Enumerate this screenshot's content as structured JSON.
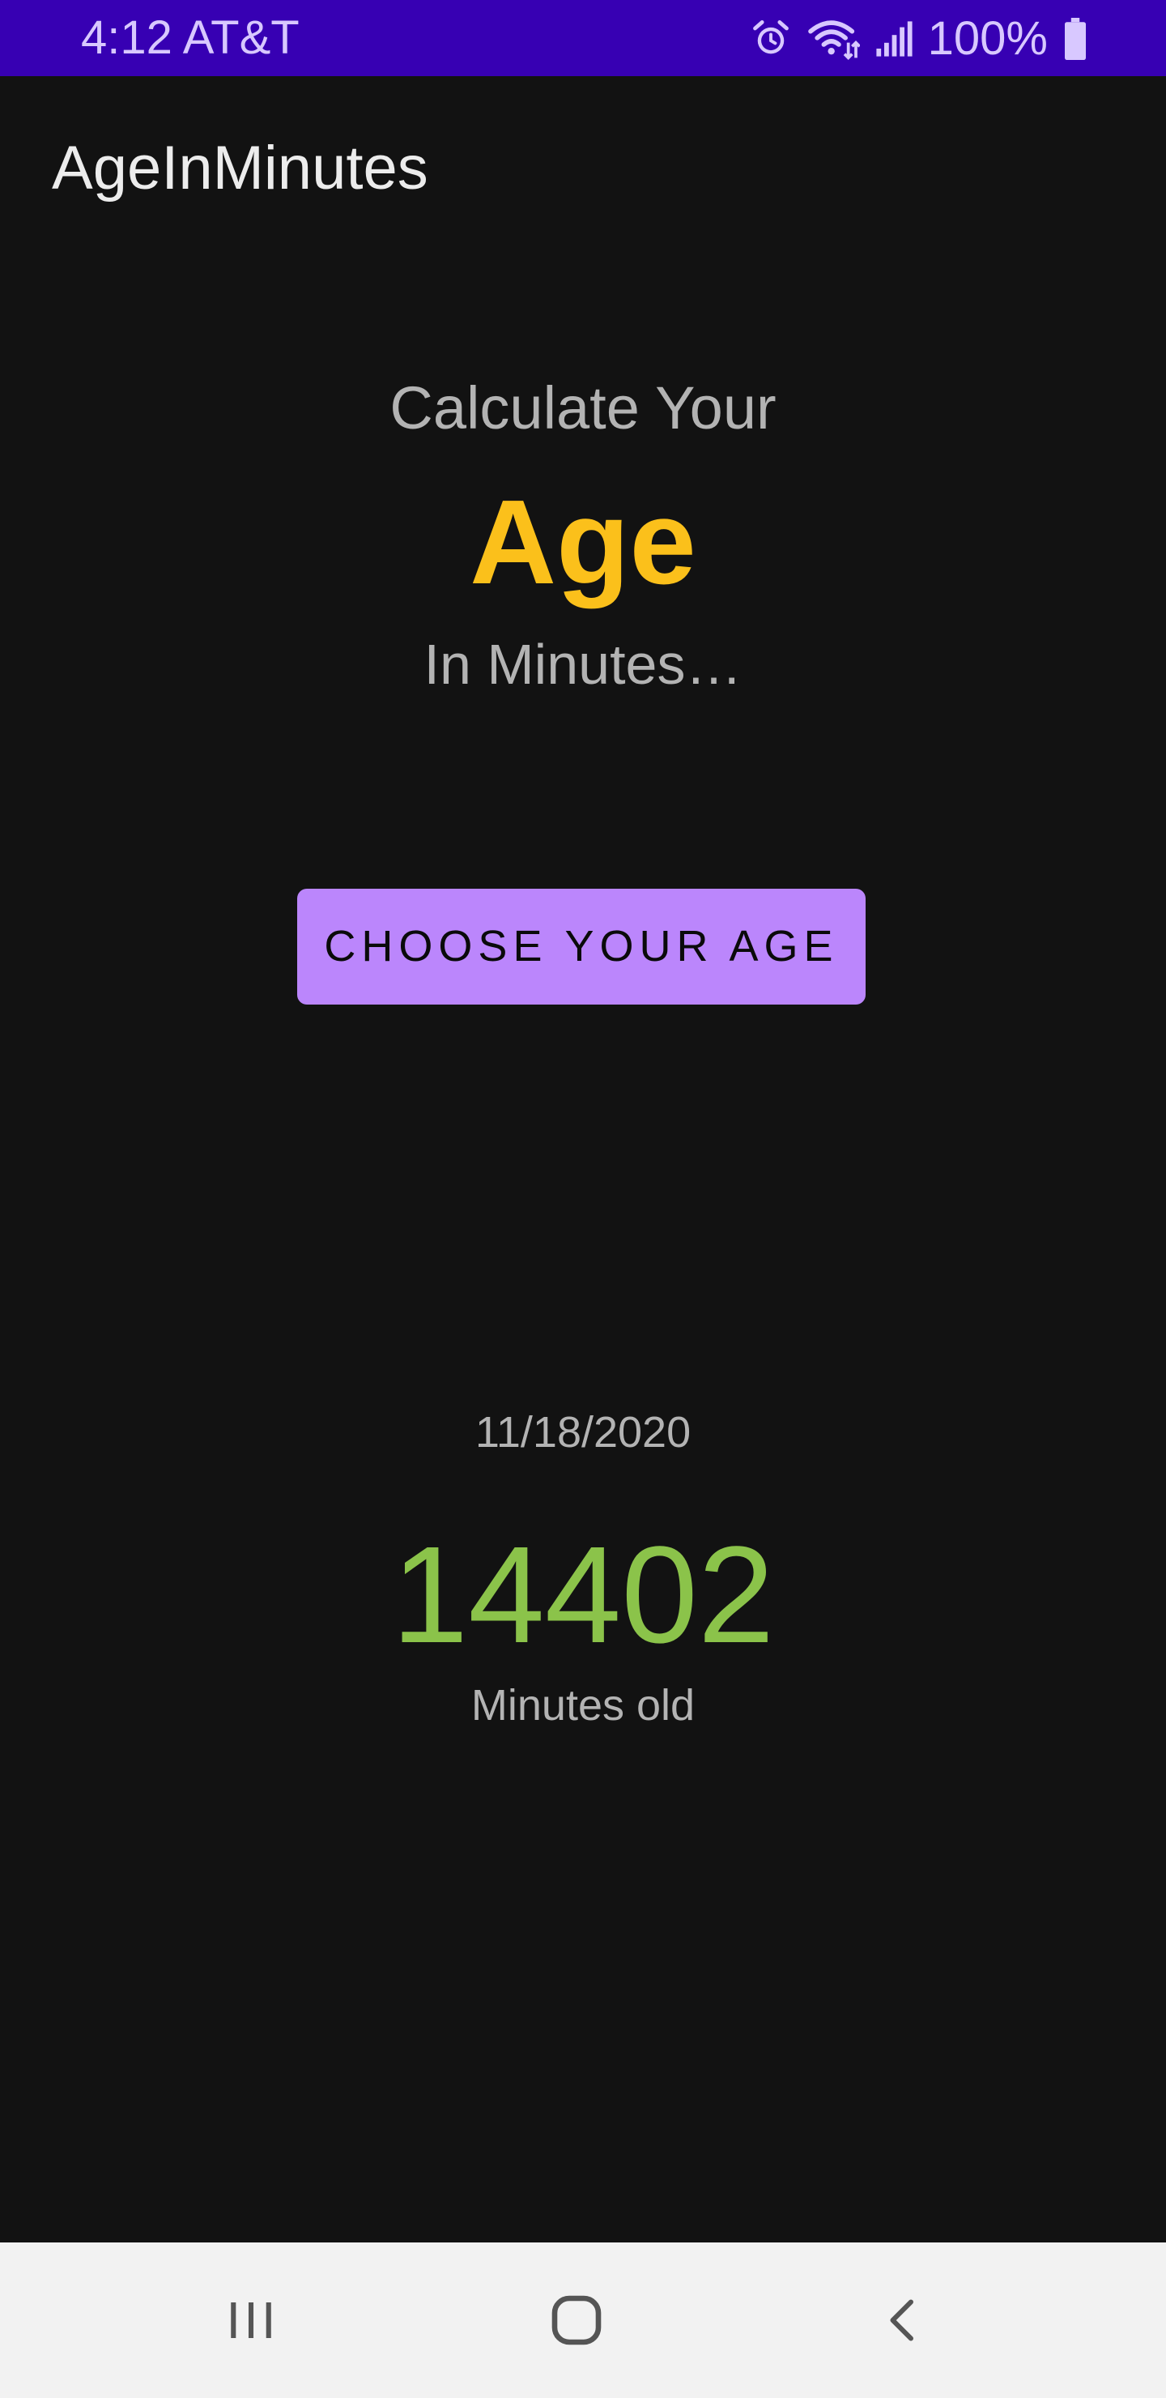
{
  "status_bar": {
    "time_carrier": "4:12 AT&T",
    "battery": "100%",
    "icons": [
      "alarm-icon",
      "wifi-icon",
      "signal-icon",
      "battery-icon"
    ],
    "background": "#3700B3"
  },
  "app_bar": {
    "title": "AgeInMinutes"
  },
  "main": {
    "headline_line1": "Calculate Your",
    "headline_line2": "Age",
    "headline_line3": "In Minutes…",
    "choose_button": "CHOOSE YOUR AGE",
    "selected_date": "11/18/2020",
    "minutes_value": "14402",
    "minutes_label": "Minutes old"
  },
  "navigation_bar": {
    "icons": [
      "recent-apps-icon",
      "home-icon",
      "back-icon"
    ]
  },
  "colors": {
    "accent_age": "#FBC01B",
    "button": "#BB86FC",
    "minutes": "#8BC34A",
    "background": "#121212"
  }
}
